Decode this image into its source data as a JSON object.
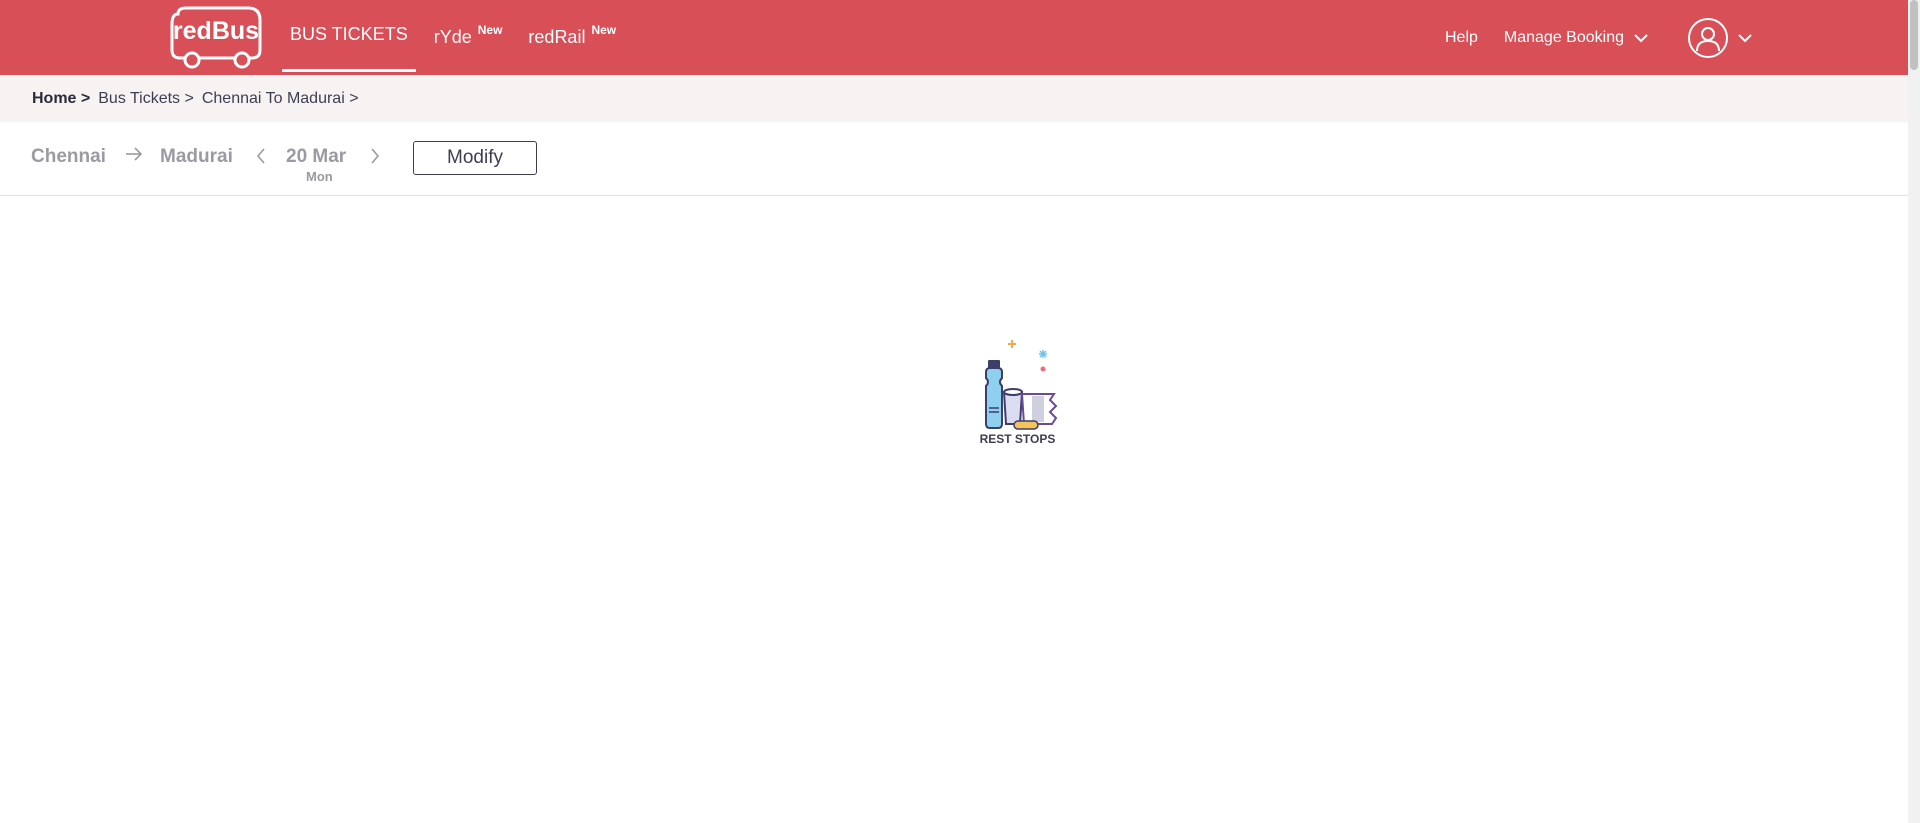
{
  "header": {
    "logo_text": "redBus",
    "nav": [
      {
        "label": "BUS TICKETS",
        "badge": ""
      },
      {
        "label": "rYde",
        "badge": "New"
      },
      {
        "label": "redRail",
        "badge": "New"
      }
    ],
    "help_label": "Help",
    "manage_booking_label": "Manage Booking"
  },
  "breadcrumb": {
    "home": "Home >",
    "items": [
      "Bus Tickets >",
      "Chennai To Madurai >"
    ]
  },
  "search": {
    "from": "Chennai",
    "to": "Madurai",
    "date": "20 Mar",
    "day": "Mon",
    "modify_label": "Modify"
  },
  "loader": {
    "caption": "REST STOPS"
  },
  "colors": {
    "brand": "#d84f57",
    "breadcrumb_bg": "#f7f3f3",
    "muted_text": "#9a9aa2",
    "dark_text": "#3e3e52"
  },
  "icons": {
    "arrow": "arrow-right-icon",
    "prev": "chevron-left-icon",
    "next": "chevron-right-icon",
    "dropdown": "chevron-down-icon",
    "user": "user-icon"
  }
}
